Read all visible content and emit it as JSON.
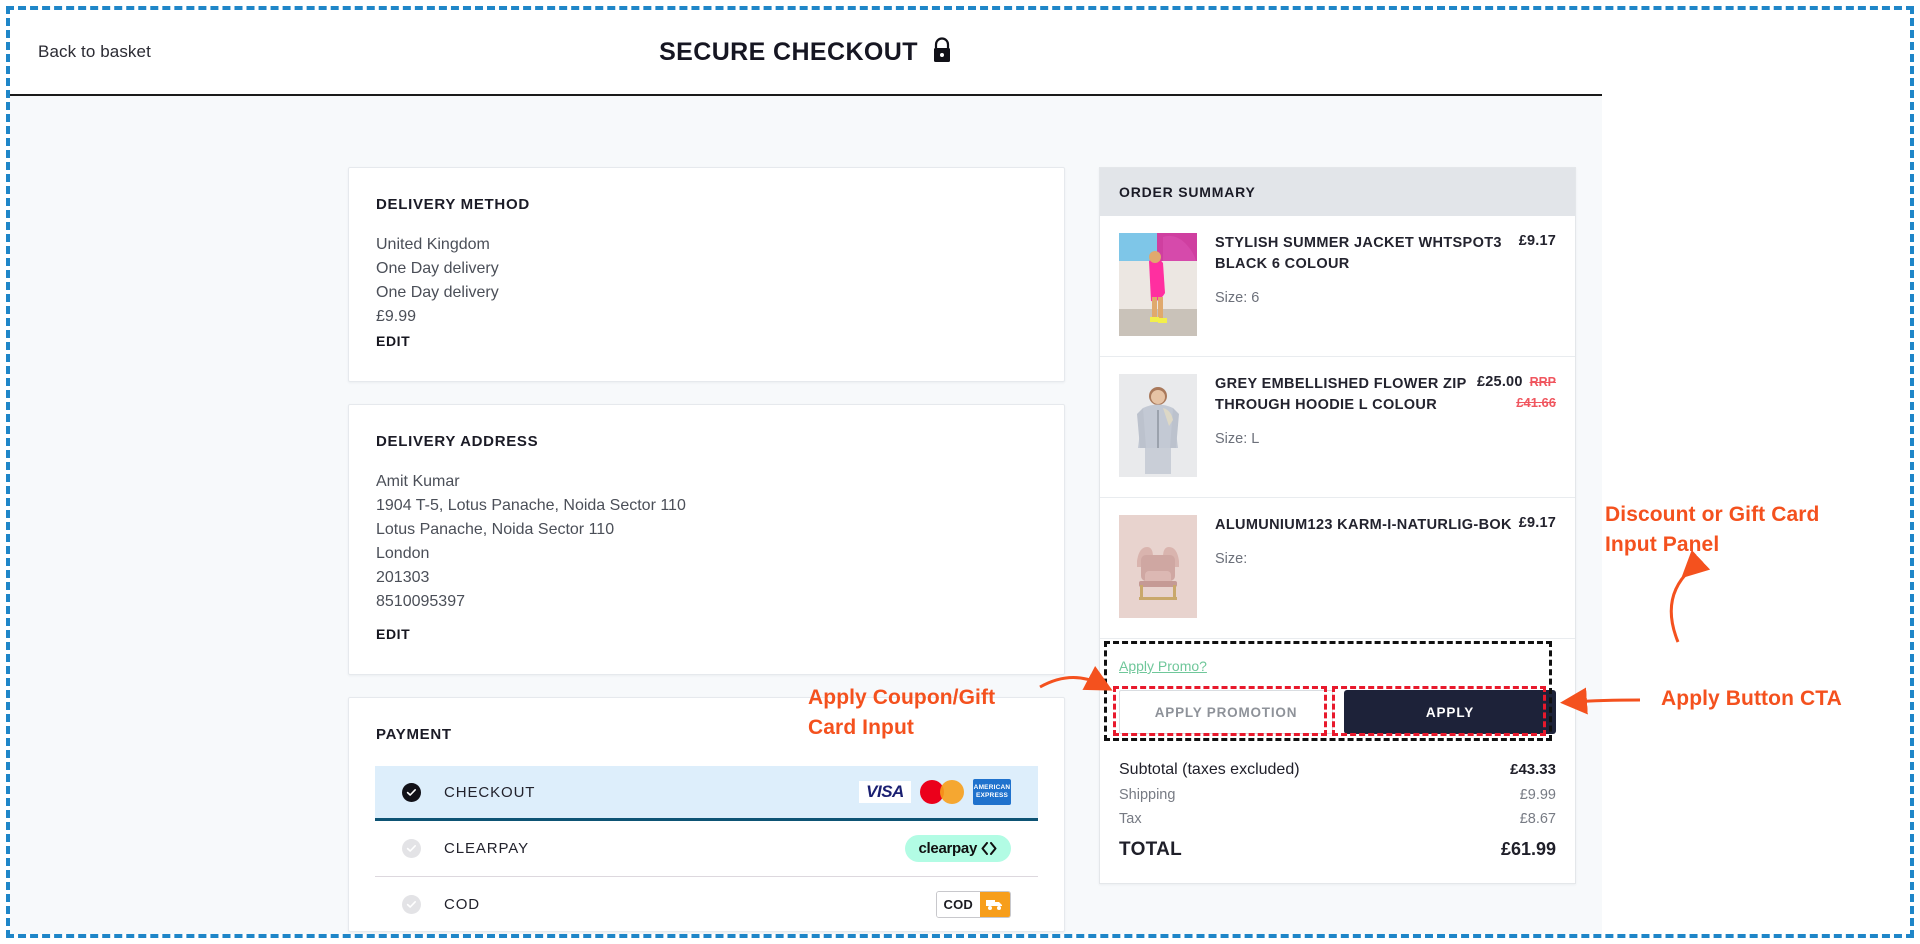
{
  "header": {
    "back_link": "Back to basket",
    "title": "SECURE CHECKOUT",
    "lock_icon": "lock-icon"
  },
  "delivery_method": {
    "title": "DELIVERY METHOD",
    "lines": [
      "United Kingdom",
      "One Day delivery",
      "One Day delivery",
      "£9.99"
    ],
    "edit_label": "EDIT"
  },
  "delivery_address": {
    "title": "DELIVERY ADDRESS",
    "lines": [
      "Amit Kumar",
      "1904 T-5, Lotus Panache, Noida Sector 110",
      "Lotus Panache, Noida Sector 110",
      "London",
      "201303",
      "8510095397"
    ],
    "edit_label": "EDIT"
  },
  "payment": {
    "title": "PAYMENT",
    "methods": [
      {
        "label": "CHECKOUT",
        "selected": true,
        "logos": [
          "visa-logo",
          "mastercard-logo",
          "amex-logo"
        ],
        "visa_text": "VISA",
        "amex_line1": "AMERICAN",
        "amex_line2": "EXPRESS"
      },
      {
        "label": "CLEARPAY",
        "selected": false,
        "logos": [
          "clearpay-logo"
        ],
        "clearpay_text": "clearpay"
      },
      {
        "label": "COD",
        "selected": false,
        "logos": [
          "cod-logo"
        ],
        "cod_text": "COD"
      }
    ]
  },
  "order_summary": {
    "title": "ORDER SUMMARY",
    "items": [
      {
        "name": "STYLISH SUMMER JACKET WHTSPOT3 BLACK 6 COLOUR",
        "price": "£9.17",
        "size_label": "Size: 6",
        "rrp_tag": "",
        "rrp_value": "",
        "thumb": "pink-dress-photo"
      },
      {
        "name": "GREY EMBELLISHED FLOWER ZIP THROUGH HOODIE L COLOUR",
        "price": "£25.00",
        "size_label": "Size: L",
        "rrp_tag": "RRP",
        "rrp_value": "£41.66",
        "thumb": "grey-hoodie-photo"
      },
      {
        "name": "ALUMUNIUM123 KARM-I-NATURLIG-BOK",
        "price": "£9.17",
        "size_label": "Size:",
        "rrp_tag": "",
        "rrp_value": "",
        "thumb": "pink-armchair-photo"
      }
    ],
    "promo": {
      "link_label": "Apply Promo?",
      "input_placeholder": "APPLY PROMOTION",
      "input_value": "",
      "apply_button": "APPLY"
    },
    "totals": [
      {
        "label": "Subtotal (taxes excluded)",
        "value": "£43.33",
        "style": "bold"
      },
      {
        "label": "Shipping",
        "value": "£9.99",
        "style": "muted"
      },
      {
        "label": "Tax",
        "value": "£8.67",
        "style": "muted"
      },
      {
        "label": "TOTAL",
        "value": "£61.99",
        "style": "grand"
      }
    ]
  },
  "annotations": {
    "coupon_input": "Apply Coupon/Gift\nCard Input",
    "discount_panel": "Discount or Gift Card\nInput Panel",
    "apply_cta": "Apply Button CTA"
  },
  "colors": {
    "annotation": "#f4511e",
    "frame": "#1f86c8",
    "red_box": "#e8192c",
    "black_box": "#111111",
    "apply_button": "#1d2239",
    "selected_row": "#ddeefb",
    "promo_link": "#6fc79a",
    "rrp": "#f0565f"
  }
}
